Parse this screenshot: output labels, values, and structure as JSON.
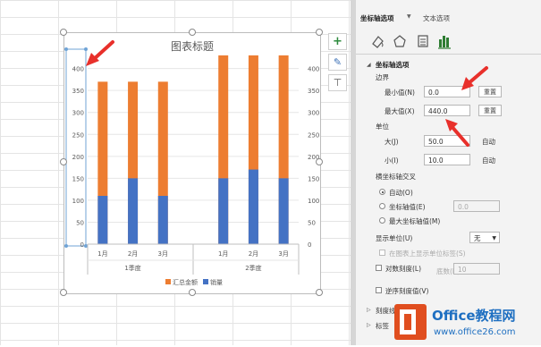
{
  "chart": {
    "title": "图表标题",
    "y_ticks_left": [
      "400",
      "350",
      "300",
      "250",
      "200",
      "150",
      "100",
      "50",
      "0"
    ],
    "y_ticks_right": [
      "400",
      "350",
      "300",
      "250",
      "200",
      "150",
      "100",
      "50",
      "0"
    ],
    "month_labels": [
      "1月",
      "2月",
      "3月",
      "1月",
      "2月",
      "3月"
    ],
    "group_labels": [
      "1季度",
      "2季度"
    ],
    "legend": [
      "汇总金额",
      "销量"
    ],
    "colors": {
      "total": "#ed7d31",
      "sales": "#4472c4"
    }
  },
  "chart_data": {
    "type": "bar",
    "title": "图表标题",
    "categories": [
      "1季度 1月",
      "1季度 2月",
      "1季度 3月",
      "2季度 1月",
      "2季度 2月",
      "2季度 3月"
    ],
    "series": [
      {
        "name": "汇总金额",
        "values": [
          370,
          370,
          370,
          430,
          430,
          430
        ]
      },
      {
        "name": "销量",
        "values": [
          110,
          150,
          110,
          150,
          170,
          150
        ]
      }
    ],
    "ylim": [
      0,
      440
    ],
    "legend_position": "bottom"
  },
  "side_buttons": [
    "+",
    "✎",
    "⊤"
  ],
  "panel": {
    "tab1": "坐标轴选项",
    "tab1_arrow": "▼",
    "tab2": "文本选项",
    "section_title": "坐标轴选项",
    "bounds_header": "边界",
    "min_label": "最小值(N)",
    "min_value": "0.0",
    "max_label": "最大值(X)",
    "max_value": "440.0",
    "reset": "重置",
    "units_header": "单位",
    "major_label": "大(J)",
    "major_value": "50.0",
    "minor_label": "小(I)",
    "minor_value": "10.0",
    "auto": "自动",
    "cross_header": "横坐标轴交叉",
    "cross_auto": "自动(O)",
    "cross_value_label": "坐标轴值(E)",
    "cross_value": "0.0",
    "cross_max": "最大坐标轴值(M)",
    "display_units_label": "显示单位(U)",
    "display_units_value": "无",
    "show_units_label": "在图表上显示单位标签(S)",
    "log_label": "对数刻度(L)",
    "log_base_label": "底数(B)",
    "log_base_value": "10",
    "reverse_label": "逆序刻度值(V)",
    "tick_marks": "刻度线",
    "labels": "标签"
  },
  "watermark": {
    "brand": "Office教程网",
    "url": "www.office26.com"
  }
}
